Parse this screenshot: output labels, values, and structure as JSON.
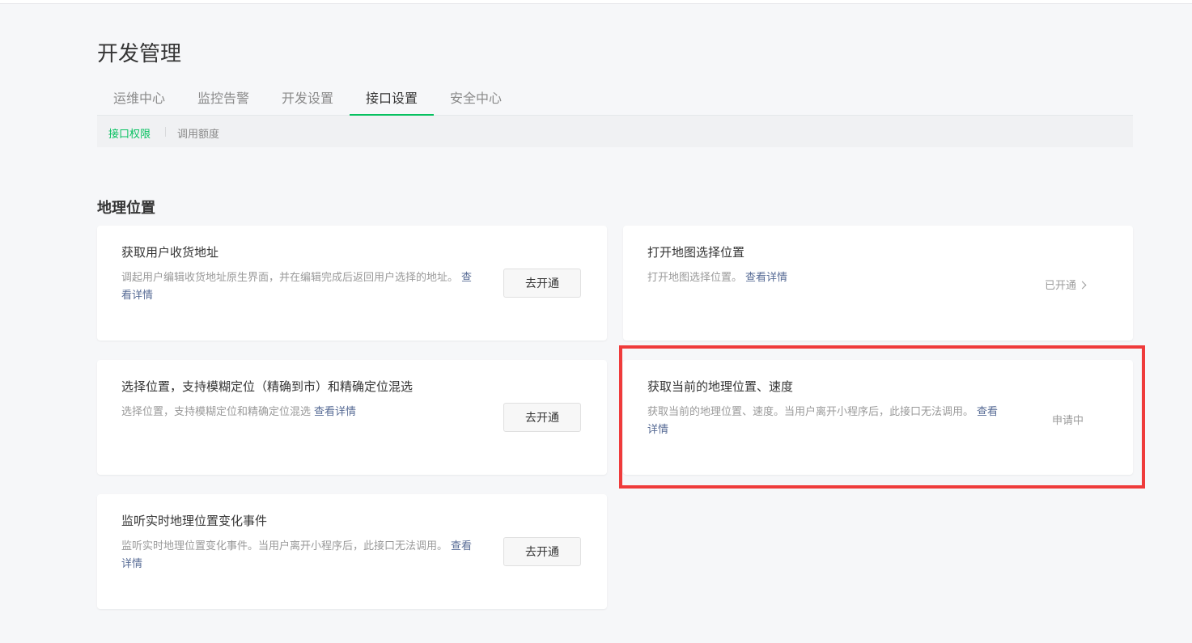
{
  "page": {
    "title": "开发管理"
  },
  "tabs": [
    {
      "label": "运维中心"
    },
    {
      "label": "监控告警"
    },
    {
      "label": "开发设置"
    },
    {
      "label": "接口设置"
    },
    {
      "label": "安全中心"
    }
  ],
  "subtabs": [
    {
      "label": "接口权限"
    },
    {
      "label": "调用额度"
    }
  ],
  "section": {
    "title": "地理位置"
  },
  "cards": [
    {
      "title": "获取用户收货地址",
      "desc": "调起用户编辑收货地址原生界面，并在编辑完成后返回用户选择的地址。",
      "link": "查看详情",
      "action": "去开通"
    },
    {
      "title": "打开地图选择位置",
      "desc": "打开地图选择位置。",
      "link": "查看详情",
      "status": "已开通"
    },
    {
      "title": "选择位置，支持模糊定位（精确到市）和精确定位混选",
      "desc": "选择位置，支持模糊定位和精确定位混选",
      "link": "查看详情",
      "action": "去开通"
    },
    {
      "title": "获取当前的地理位置、速度",
      "desc": "获取当前的地理位置、速度。当用户离开小程序后，此接口无法调用。",
      "link": "查看详情",
      "status": "申请中"
    },
    {
      "title": "监听实时地理位置变化事件",
      "desc": "监听实时地理位置变化事件。当用户离开小程序后，此接口无法调用。",
      "link": "查看详情",
      "action": "去开通"
    }
  ],
  "colors": {
    "accent": "#07c160",
    "link": "#576b95",
    "highlight": "#ef3b3b"
  }
}
